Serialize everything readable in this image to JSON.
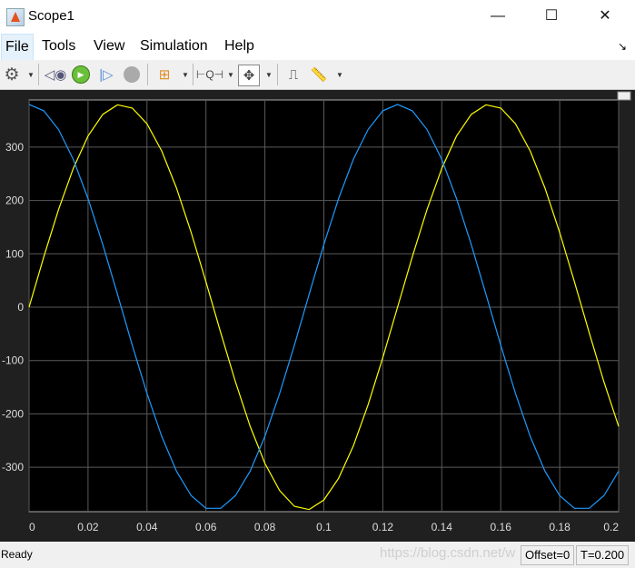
{
  "window": {
    "title": "Scope1",
    "minimize": "—",
    "maximize": "☐",
    "close": "✕"
  },
  "menu": [
    "File",
    "Tools",
    "View",
    "Simulation",
    "Help"
  ],
  "toolbar": {
    "icons": [
      "gear-icon",
      "step-back-icon",
      "run-icon",
      "step-forward-icon",
      "stop-icon",
      "signal-selector-icon",
      "zoom-icon",
      "fit-to-view-icon",
      "triggers-icon",
      "measurements-icon"
    ]
  },
  "status": {
    "text": "Ready",
    "offset": "Offset=0",
    "time": "T=0.200",
    "watermark": "https://blog.csdn.net/w"
  },
  "colors": {
    "background": "#000000",
    "grid": "#5a5a5a",
    "series1": "#ffff00",
    "series2": "#1e9bff"
  },
  "chart_data": {
    "type": "line",
    "xlim": [
      0,
      0.2
    ],
    "ylim": [
      -400,
      400
    ],
    "grid": true,
    "xticks": [
      "0",
      "0.02",
      "0.04",
      "0.06",
      "0.08",
      "0.1",
      "0.12",
      "0.14",
      "0.16",
      "0.18",
      "0.2"
    ],
    "yticks": [
      "-300",
      "-200",
      "-100",
      "0",
      "100",
      "200",
      "300"
    ],
    "x_step": 0.005,
    "series": [
      {
        "color": "#ffff00",
        "values": [
          0,
          94.5,
          183.1,
          260.1,
          320.8,
          361.4,
          379.3,
          373.3,
          343.8,
          292.8,
          223.4,
          139.9,
          47.6,
          -47.6,
          -139.9,
          -223.4,
          -292.8,
          -343.8,
          -373.3,
          -379.3,
          -361.4,
          -320.8,
          -260.1,
          -183.1,
          -94.5,
          0,
          94.5,
          183.1,
          260.1,
          320.8,
          361.4,
          379.3,
          373.3,
          343.8,
          292.8,
          223.4,
          139.9,
          47.6,
          -47.6,
          -139.9,
          -223.4
        ]
      },
      {
        "color": "#1e9bff",
        "values": [
          380,
          368.1,
          333.0,
          277.0,
          203.6,
          117.4,
          23.9,
          -71.2,
          -161.8,
          -242.2,
          -307.4,
          -353.3,
          -377.0,
          -377.0,
          -353.3,
          -307.4,
          -242.2,
          -161.8,
          -71.2,
          23.9,
          117.4,
          203.6,
          277.0,
          333.0,
          368.1,
          380,
          368.1,
          333.0,
          277.0,
          203.6,
          117.4,
          23.9,
          -71.2,
          -161.8,
          -242.2,
          -307.4,
          -353.3,
          -377.0,
          -377.0,
          -353.3,
          -307.4
        ]
      }
    ]
  }
}
